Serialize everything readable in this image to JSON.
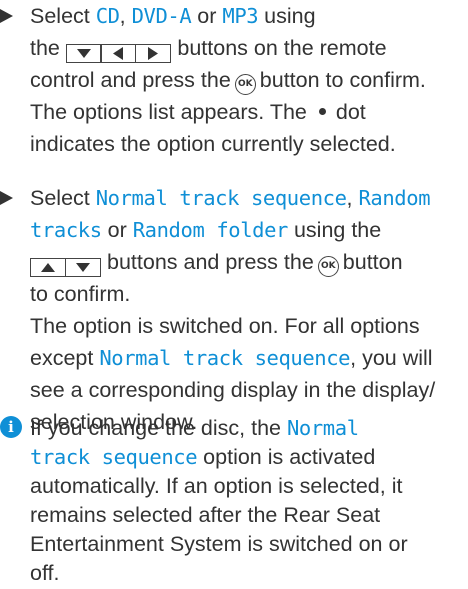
{
  "step1": {
    "line1_pre": "Select ",
    "cd": "CD",
    "sep1": ", ",
    "dvda": "DVD-A",
    "or": " or ",
    "mp3": "MP3",
    "line1_post": " using",
    "line2_pre": "the",
    "line2_post": "buttons on the remote",
    "line3_pre": "control and press the",
    "line3_post": "button to confirm.",
    "line4": "The options list appears. The",
    "line4_post": "dot",
    "line5": "indicates the option currently selected."
  },
  "step2": {
    "line1_pre": "Select ",
    "normal": "Normal track sequence",
    "sep": ", ",
    "random_a": "Random",
    "random_b": "tracks",
    "or": " or ",
    "random_folder": "Random folder",
    "line2_post": " using the",
    "line3_post": "buttons and press the",
    "line3_end": "button",
    "line4": "to confirm.",
    "line5": "The option is switched on. For all options",
    "line6_pre": "except ",
    "line6_hl": "Normal track sequence",
    "line6_post": ", you will",
    "line7": "see a corresponding display in the display/",
    "line8": "selection window."
  },
  "note": {
    "icon": "i",
    "line1_pre": "If you change the disc, the ",
    "line1_hl": "Normal",
    "line2_hl": "track sequence",
    "line2_post": " option is activated",
    "line3": "automatically. If an option is selected, it",
    "line4": "remains selected after the Rear Seat",
    "line5": "Entertainment System is switched on or",
    "line6": "off."
  },
  "ok_label": "OK",
  "colors": {
    "highlight": "#0f8fd6",
    "text": "#333333"
  },
  "icons": [
    "down-arrow-icon",
    "left-arrow-icon",
    "right-arrow-icon",
    "up-arrow-icon",
    "ok-button-icon",
    "bullet-dot-icon",
    "info-icon"
  ]
}
